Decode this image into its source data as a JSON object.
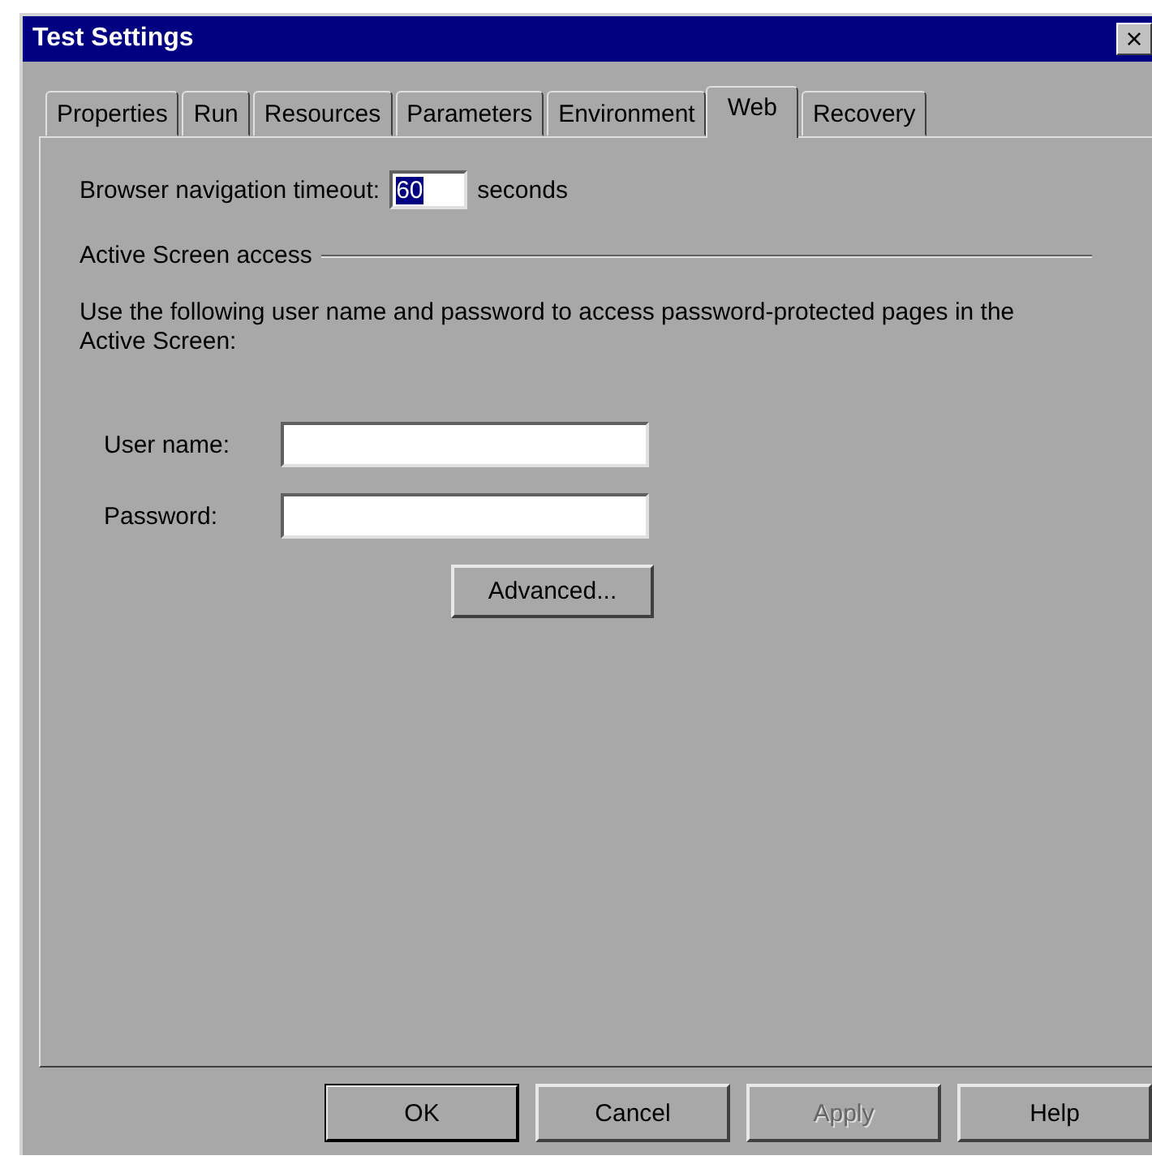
{
  "window": {
    "title": "Test Settings",
    "close": "×"
  },
  "tabs": [
    {
      "label": "Properties",
      "selected": false
    },
    {
      "label": "Run",
      "selected": false
    },
    {
      "label": "Resources",
      "selected": false
    },
    {
      "label": "Parameters",
      "selected": false
    },
    {
      "label": "Environment",
      "selected": false
    },
    {
      "label": "Web",
      "selected": true
    },
    {
      "label": "Recovery",
      "selected": false
    }
  ],
  "timeout": {
    "label": "Browser navigation timeout:",
    "value": "60",
    "value_selected": true,
    "unit": "seconds"
  },
  "group": {
    "title": "Active Screen access",
    "description": "Use the following user name and password to access password-protected pages in the Active Screen:"
  },
  "fields": [
    {
      "label": "User name:"
    },
    {
      "label": "Password:"
    }
  ],
  "advanced_button": "Advanced...",
  "buttons": [
    {
      "label": "OK",
      "default": true,
      "disabled": false
    },
    {
      "label": "Cancel",
      "default": false,
      "disabled": false
    },
    {
      "label": "Apply",
      "default": false,
      "disabled": true
    },
    {
      "label": "Help",
      "default": false,
      "disabled": false
    }
  ]
}
